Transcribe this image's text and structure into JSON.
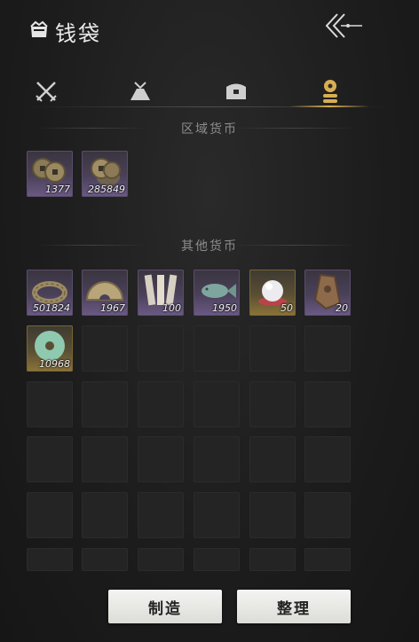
{
  "header": {
    "title": "钱袋"
  },
  "tabs": [
    {
      "name": "tab-weapons",
      "icon": "crossed-swords-icon"
    },
    {
      "name": "tab-pouch",
      "icon": "pouch-icon"
    },
    {
      "name": "tab-chest",
      "icon": "chest-icon"
    },
    {
      "name": "tab-currency",
      "icon": "coins-icon",
      "active": true
    }
  ],
  "sections": {
    "regional": {
      "title": "区域货币",
      "items": [
        {
          "icon": "copper-coins-icon",
          "quantity": "1377",
          "rarity": "purple"
        },
        {
          "icon": "coin-stack-icon",
          "quantity": "285849",
          "rarity": "purple"
        }
      ]
    },
    "other": {
      "title": "其他货币",
      "items": [
        {
          "icon": "coin-string-icon",
          "quantity": "501824",
          "rarity": "purple"
        },
        {
          "icon": "half-coin-icon",
          "quantity": "1967",
          "rarity": "purple"
        },
        {
          "icon": "bamboo-slips-icon",
          "quantity": "100",
          "rarity": "purple"
        },
        {
          "icon": "jade-fish-icon",
          "quantity": "1950",
          "rarity": "purple"
        },
        {
          "icon": "pearl-icon",
          "quantity": "50",
          "rarity": "gold"
        },
        {
          "icon": "bronze-token-icon",
          "quantity": "20",
          "rarity": "purple"
        },
        {
          "icon": "jade-disc-icon",
          "quantity": "10968",
          "rarity": "gold"
        }
      ]
    }
  },
  "buttons": {
    "craft": "制造",
    "sort": "整理"
  },
  "colors": {
    "accent_gold": "#d8ae52",
    "rarity_purple": "#6b5a86",
    "rarity_gold": "#8c7438"
  }
}
